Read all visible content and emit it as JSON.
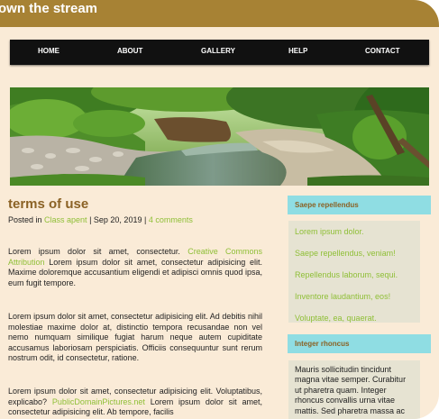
{
  "site": {
    "title": "own the stream"
  },
  "nav": {
    "items": [
      "HOME",
      "ABOUT",
      "GALLERY",
      "HELP",
      "CONTACT"
    ]
  },
  "post": {
    "title": "terms of use",
    "meta": {
      "prefix": "Posted in ",
      "category": "Class apent",
      "sep1": " | ",
      "date": "Sep 20, 2019",
      "sep2": " | ",
      "comments": "4 comments"
    },
    "p1": {
      "text_before": "Lorem ipsum dolor sit amet, consectetur. ",
      "link": "Creative Commons Attribution",
      "text_after": " Lorem ipsum dolor sit amet, consectetur adipisicing elit. Maxime doloremque accusantium eligendi et adipisci omnis quod ipsa, eum fugit tempore."
    },
    "p2": {
      "text": "Lorem ipsum dolor sit amet, consectetur adipisicing elit. Ad debitis nihil molestiae maxime dolor at, distinctio tempora recusandae non vel nemo numquam similique fugiat harum neque autem cupiditate accusamus laboriosam perspiciatis. Officiis consequuntur sunt rerum nostrum odit, id consectetur, ratione."
    },
    "p3": {
      "text_before": "Lorem ipsum dolor sit amet, consectetur adipisicing elit. Voluptatibus, explicabo? ",
      "link": "PublicDomainPictures.net",
      "text_after": " Lorem ipsum dolor sit amet, consectetur adipisicing elit. Ab tempore, facilis"
    }
  },
  "sidebar": {
    "widget1": {
      "title": "Saepe repellendus",
      "links": [
        "Lorem ipsum dolor.",
        "Saepe repellendus, veniam!",
        "Repellendus laborum, sequi.",
        "Inventore laudantium, eos!",
        "Voluptate, ea, quaerat."
      ]
    },
    "widget2": {
      "title": "Integer rhoncus",
      "text": "Mauris sollicitudin tincidunt magna vitae semper. Curabitur ut pharetra quam. Integer rhoncus convallis urna vitae mattis. Sed pharetra massa ac"
    }
  },
  "colors": {
    "header": "#a78234",
    "background": "#faebd7",
    "nav": "#111111",
    "link": "#8fbf37",
    "title": "#8b6225",
    "widget_header": "#8fdde3",
    "widget_box": "#e6e3d2"
  }
}
